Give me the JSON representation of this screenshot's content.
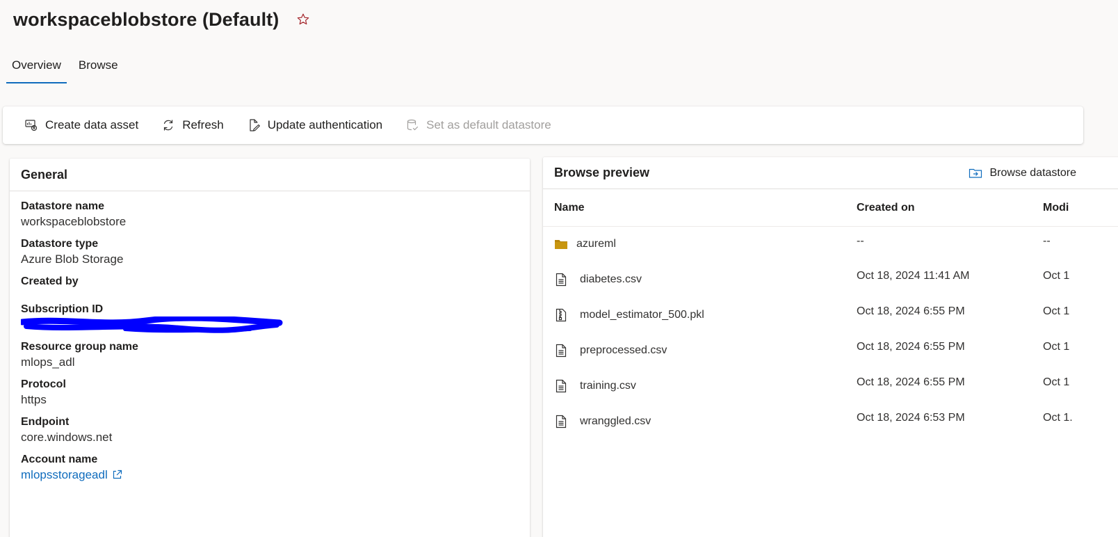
{
  "header": {
    "title": "workspaceblobstore (Default)"
  },
  "tabs": [
    {
      "label": "Overview"
    },
    {
      "label": "Browse"
    }
  ],
  "toolbar": {
    "create_data_asset": "Create data asset",
    "refresh": "Refresh",
    "update_authentication": "Update authentication",
    "set_default": "Set as default datastore"
  },
  "general": {
    "title": "General",
    "datastore_name_label": "Datastore name",
    "datastore_name_value": "workspaceblobstore",
    "datastore_type_label": "Datastore type",
    "datastore_type_value": "Azure Blob Storage",
    "created_by_label": "Created by",
    "subscription_id_label": "Subscription ID",
    "resource_group_label": "Resource group name",
    "resource_group_value": "mlops_adl",
    "protocol_label": "Protocol",
    "protocol_value": "https",
    "endpoint_label": "Endpoint",
    "endpoint_value": "core.windows.net",
    "account_name_label": "Account name",
    "account_name_value": "mlopsstorageadl"
  },
  "browse_preview": {
    "title": "Browse preview",
    "browse_datastore": "Browse datastore",
    "columns": {
      "name": "Name",
      "created": "Created on",
      "modified": "Modi"
    },
    "rows": [
      {
        "name": "azureml",
        "created": "--",
        "modified": "--",
        "icon": "folder-icon"
      },
      {
        "name": "diabetes.csv",
        "created": "Oct 18, 2024 11:41 AM",
        "modified": "Oct 1",
        "icon": "document-icon"
      },
      {
        "name": "model_estimator_500.pkl",
        "created": "Oct 18, 2024 6:55 PM",
        "modified": "Oct 1",
        "icon": "zip-file-icon"
      },
      {
        "name": "preprocessed.csv",
        "created": "Oct 18, 2024 6:55 PM",
        "modified": "Oct 1",
        "icon": "document-icon"
      },
      {
        "name": "training.csv",
        "created": "Oct 18, 2024 6:55 PM",
        "modified": "Oct 1",
        "icon": "document-icon"
      },
      {
        "name": "wranggled.csv",
        "created": "Oct 18, 2024 6:53 PM",
        "modified": "Oct 1.",
        "icon": "document-icon"
      }
    ]
  },
  "colors": {
    "accent": "#0f6cbd",
    "star": "#a4262c",
    "folder": "#b8860b",
    "redaction": "#0000ff"
  }
}
